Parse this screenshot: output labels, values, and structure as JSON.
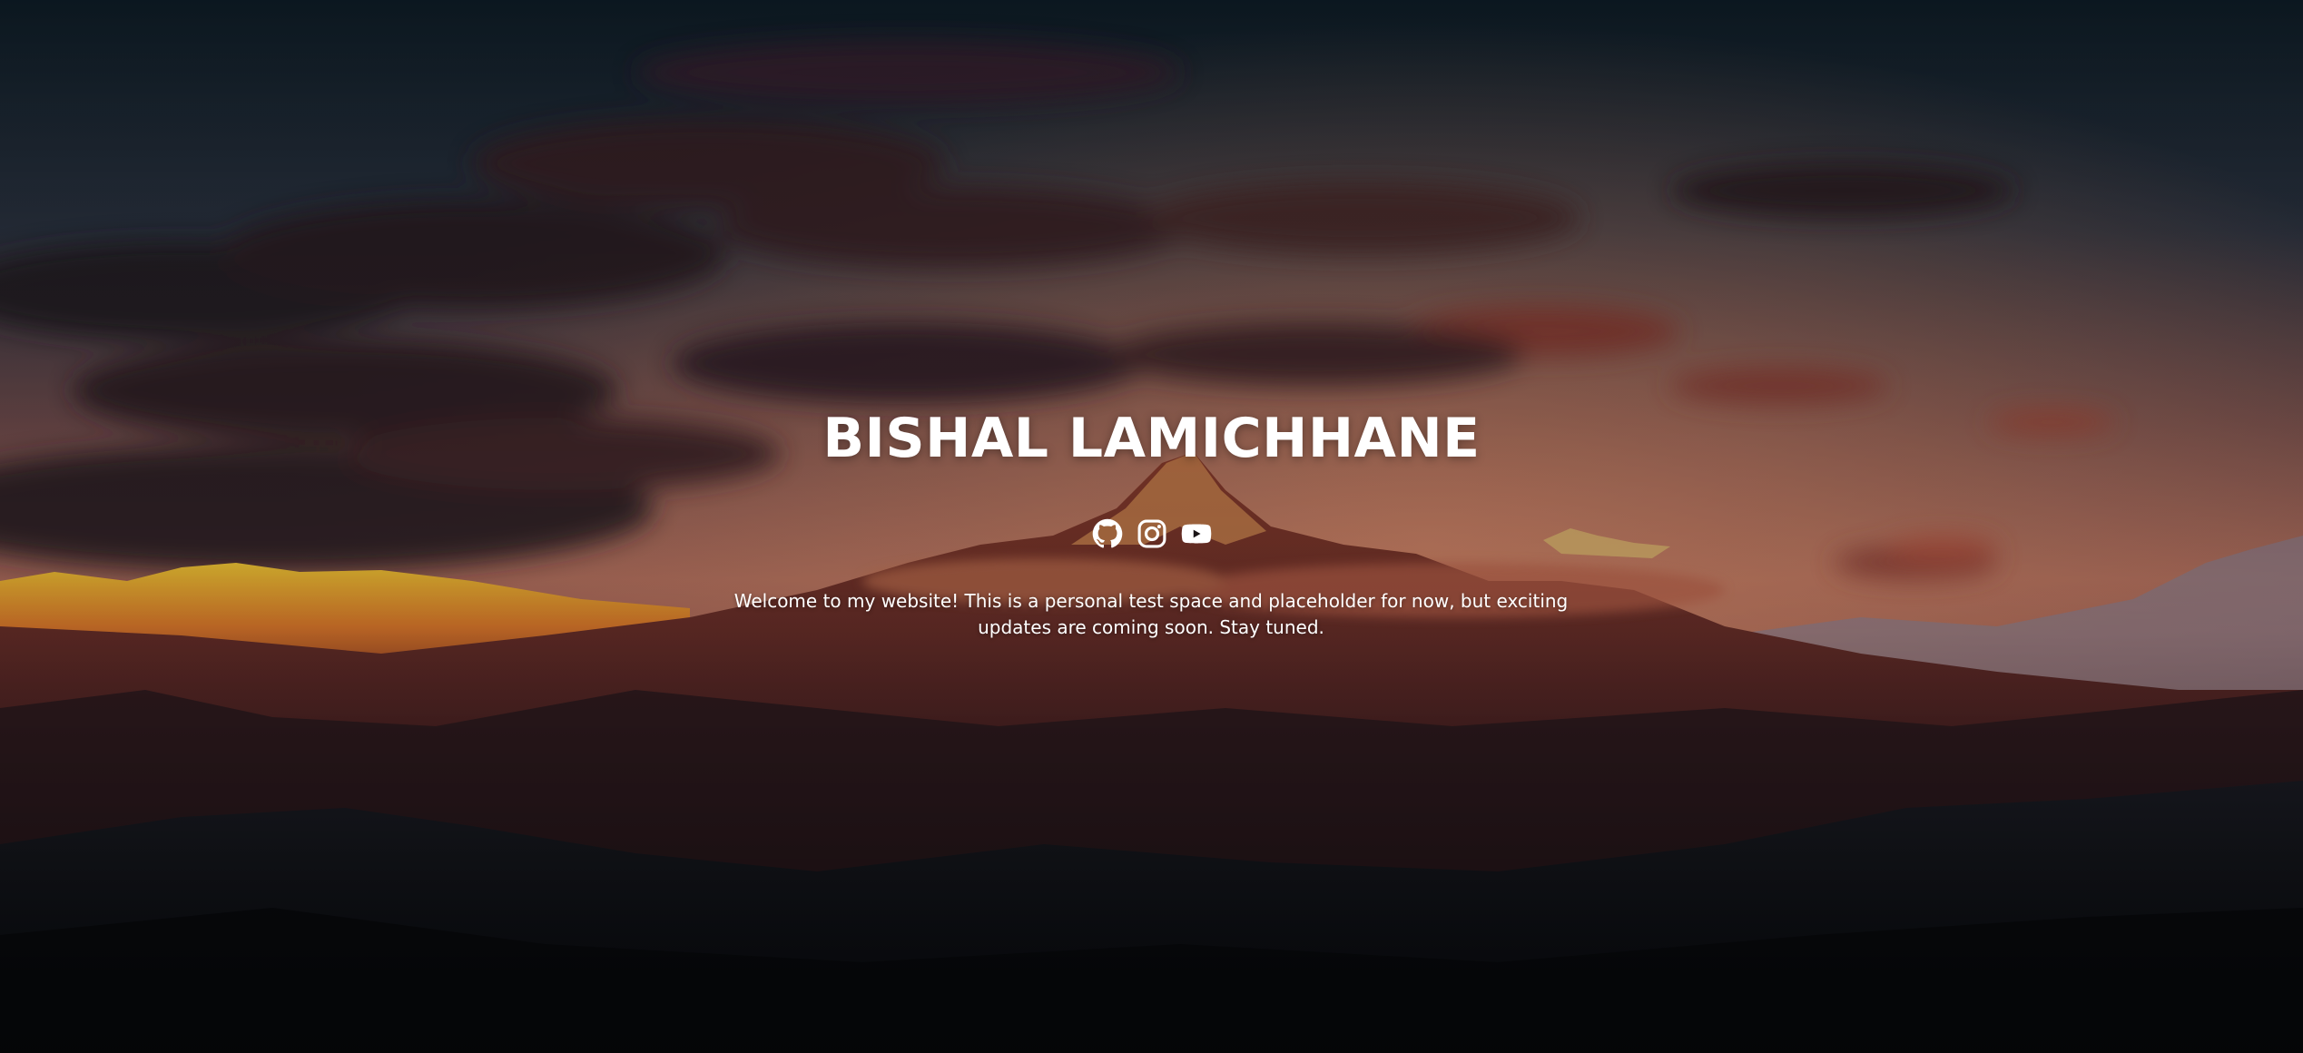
{
  "hero": {
    "title": "BISHAL LAMICHHANE",
    "description": "Welcome to my website! This is a personal test space and placeholder for now, but exciting updates are coming soon. Stay tuned.",
    "background": "mountain-sunset-photo"
  },
  "socials": [
    {
      "icon": "github-icon"
    },
    {
      "icon": "instagram-icon"
    },
    {
      "icon": "youtube-icon"
    }
  ],
  "colors": {
    "text": "#ffffff",
    "sky_top": "#0f1f2a",
    "sky_glow": "#c87a5e",
    "peak_highlight": "#e6a51e"
  }
}
